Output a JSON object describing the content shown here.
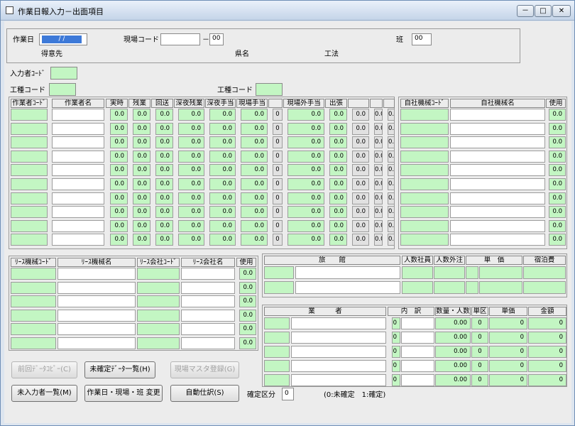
{
  "window": {
    "title": "作業日報入力－出面項目",
    "min": "－",
    "max": "□",
    "close": "✕"
  },
  "header": {
    "sagyobi_label": "作業日",
    "date_value": "/ /",
    "genba_label": "現場コード",
    "genba_dash": "－",
    "genba_sub": "00",
    "han_label": "班",
    "han_value": "00",
    "tokuisaki_label": "得意先",
    "kenmei_label": "県名",
    "kouhou_label": "工法"
  },
  "inputter": {
    "label": "入力者ｺｰﾄﾞ",
    "value": ""
  },
  "koushu1": {
    "label": "工種コード",
    "value": ""
  },
  "koushu2": {
    "label": "工種コード",
    "value": ""
  },
  "worker_table": {
    "headers": [
      "作業者ｺｰﾄﾞ",
      "作業者名",
      "実時",
      "残業",
      "回送",
      "深夜残業",
      "深夜手当",
      "現場手当",
      "",
      "現場外手当",
      "出張",
      "",
      "",
      ""
    ],
    "rows": [
      [
        "",
        "",
        "0.0",
        "0.0",
        "0.0",
        "0.0",
        "0.0",
        "0.0",
        "0",
        "0.0",
        "0.0",
        "0.0",
        "0.0",
        "0.0"
      ],
      [
        "",
        "",
        "0.0",
        "0.0",
        "0.0",
        "0.0",
        "0.0",
        "0.0",
        "0",
        "0.0",
        "0.0",
        "0.0",
        "0.0",
        "0.0"
      ],
      [
        "",
        "",
        "0.0",
        "0.0",
        "0.0",
        "0.0",
        "0.0",
        "0.0",
        "0",
        "0.0",
        "0.0",
        "0.0",
        "0.0",
        "0.0"
      ],
      [
        "",
        "",
        "0.0",
        "0.0",
        "0.0",
        "0.0",
        "0.0",
        "0.0",
        "0",
        "0.0",
        "0.0",
        "0.0",
        "0.0",
        "0.0"
      ],
      [
        "",
        "",
        "0.0",
        "0.0",
        "0.0",
        "0.0",
        "0.0",
        "0.0",
        "0",
        "0.0",
        "0.0",
        "0.0",
        "0.0",
        "0.0"
      ],
      [
        "",
        "",
        "0.0",
        "0.0",
        "0.0",
        "0.0",
        "0.0",
        "0.0",
        "0",
        "0.0",
        "0.0",
        "0.0",
        "0.0",
        "0.0"
      ],
      [
        "",
        "",
        "0.0",
        "0.0",
        "0.0",
        "0.0",
        "0.0",
        "0.0",
        "0",
        "0.0",
        "0.0",
        "0.0",
        "0.0",
        "0.0"
      ],
      [
        "",
        "",
        "0.0",
        "0.0",
        "0.0",
        "0.0",
        "0.0",
        "0.0",
        "0",
        "0.0",
        "0.0",
        "0.0",
        "0.0",
        "0.0"
      ],
      [
        "",
        "",
        "0.0",
        "0.0",
        "0.0",
        "0.0",
        "0.0",
        "0.0",
        "0",
        "0.0",
        "0.0",
        "0.0",
        "0.0",
        "0.0"
      ],
      [
        "",
        "",
        "0.0",
        "0.0",
        "0.0",
        "0.0",
        "0.0",
        "0.0",
        "0",
        "0.0",
        "0.0",
        "0.0",
        "0.0",
        "0.0"
      ]
    ]
  },
  "own_machine_table": {
    "headers": [
      "自社機械ｺｰﾄﾞ",
      "自社機械名",
      "使用"
    ],
    "rows": [
      [
        "",
        "",
        "0.0"
      ],
      [
        "",
        "",
        "0.0"
      ],
      [
        "",
        "",
        "0.0"
      ],
      [
        "",
        "",
        "0.0"
      ],
      [
        "",
        "",
        "0.0"
      ],
      [
        "",
        "",
        "0.0"
      ],
      [
        "",
        "",
        "0.0"
      ],
      [
        "",
        "",
        "0.0"
      ],
      [
        "",
        "",
        "0.0"
      ],
      [
        "",
        "",
        "0.0"
      ]
    ]
  },
  "lease_table": {
    "headers": [
      "ﾘｰｽ機械ｺｰﾄﾞ",
      "ﾘｰｽ機械名",
      "ﾘｰｽ会社ｺｰﾄﾞ",
      "ﾘｰｽ会社名",
      "使用"
    ],
    "rows": [
      [
        "",
        "",
        "",
        "",
        "0.0"
      ],
      [
        "",
        "",
        "",
        "",
        "0.0"
      ],
      [
        "",
        "",
        "",
        "",
        "0.0"
      ],
      [
        "",
        "",
        "",
        "",
        "0.0"
      ],
      [
        "",
        "",
        "",
        "",
        "0.0"
      ],
      [
        "",
        "",
        "",
        "",
        "0.0"
      ]
    ]
  },
  "ryokan_table": {
    "headers": [
      "旅　　館",
      "人数社員",
      "人数外注",
      "単　価",
      "宿泊費"
    ],
    "rows": [
      [
        "",
        "",
        "",
        "",
        "",
        "",
        ""
      ],
      [
        "",
        "",
        "",
        "",
        "",
        "",
        ""
      ]
    ]
  },
  "gyosha_table": {
    "headers": [
      "業　　　者",
      "内　訳",
      "数量・人数",
      "単区",
      "単価",
      "金額"
    ],
    "rows": [
      [
        "",
        "",
        "0",
        "",
        "0.00",
        "0",
        "0",
        "0"
      ],
      [
        "",
        "",
        "0",
        "",
        "0.00",
        "0",
        "0",
        "0"
      ],
      [
        "",
        "",
        "0",
        "",
        "0.00",
        "0",
        "0",
        "0"
      ],
      [
        "",
        "",
        "0",
        "",
        "0.00",
        "0",
        "0",
        "0"
      ],
      [
        "",
        "",
        "0",
        "",
        "0.00",
        "0",
        "0",
        "0"
      ]
    ]
  },
  "buttons": {
    "prev_copy": "前回ﾃﾞｰﾀｺﾋﾟｰ(C)",
    "unconfirmed_list": "未確定ﾃﾞｰﾀ一覧(H)",
    "genba_master": "現場マスタ登録(G)",
    "not_entered_list": "未入力者一覧(M)",
    "change": "作業日・現場・班 変更",
    "auto_journal": "自動仕訳(S)"
  },
  "kakutei": {
    "label": "確定区分",
    "value": "0",
    "hint": "(0:未確定　1:確定)"
  }
}
